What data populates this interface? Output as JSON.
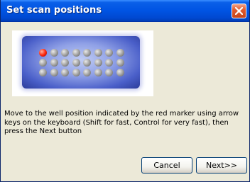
{
  "window": {
    "title": "Set scan positions"
  },
  "plate": {
    "rows": 3,
    "columns": 8,
    "marker_position": {
      "row": 1,
      "column": 1
    },
    "marker_color": "#ff2b10",
    "background_color": "#4a5fc9"
  },
  "instructions": "Move to the well position indicated by the red marker using arrow keys on the keyboard (Shift for fast, Control for very fast), then press the Next button",
  "buttons": {
    "cancel": "Cancel",
    "next": "Next>>"
  },
  "icons": {
    "close": "close-icon"
  }
}
